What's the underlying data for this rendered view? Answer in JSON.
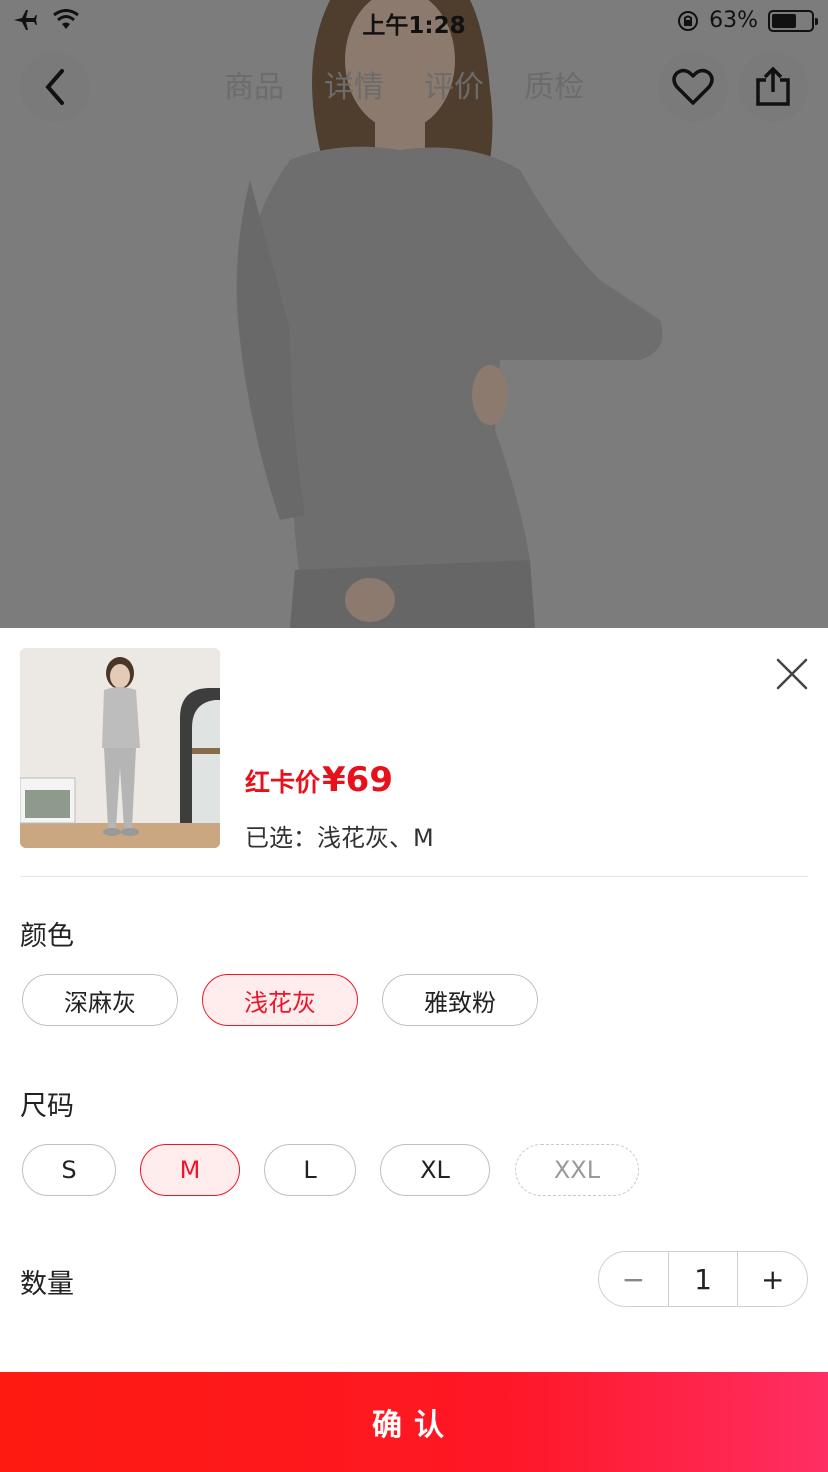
{
  "status_bar": {
    "time": "上午1:28",
    "battery": "63%",
    "battery_level": 0.63
  },
  "nav": {
    "tabs": [
      "商品",
      "详情",
      "评价",
      "质检"
    ]
  },
  "product": {
    "price_label": "红卡价",
    "price_value": "¥69",
    "selected": "已选：浅花灰、M"
  },
  "color": {
    "title": "颜色",
    "options": [
      "深麻灰",
      "浅花灰",
      "雅致粉"
    ],
    "selected": "浅花灰"
  },
  "size": {
    "title": "尺码",
    "options": [
      "S",
      "M",
      "L",
      "XL",
      "XXL"
    ],
    "selected": "M",
    "disabled": [
      "XXL"
    ]
  },
  "quantity": {
    "title": "数量",
    "minus": "−",
    "value": "1",
    "plus": "+"
  },
  "confirm_label": "确认",
  "colors": {
    "accent": "#f0142a",
    "accent_bg": "#ffeced",
    "button_start": "#fe1a10",
    "button_end": "#ff2e63"
  }
}
